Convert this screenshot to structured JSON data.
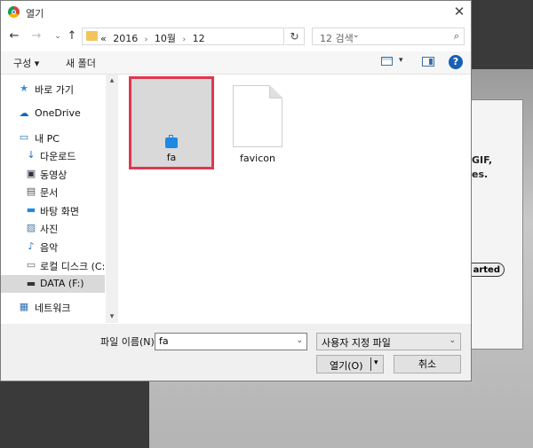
{
  "background_app": {
    "text_gif": "GIF,",
    "text_es": "es.",
    "button_label": "arted"
  },
  "dialog": {
    "title": "열기",
    "close_glyph": "✕"
  },
  "nav": {
    "back_glyph": "←",
    "forward_glyph": "→",
    "up_glyph": "↑",
    "breadcrumb_prefix": "«",
    "breadcrumbs": [
      "2016",
      "10월",
      "12"
    ],
    "breadcrumb_sep": "›",
    "dropdown_glyph": "⌄",
    "refresh_glyph": "↻",
    "search_placeholder": "12 검색",
    "search_glyph": "⌕"
  },
  "toolbar": {
    "organize": "구성 ▾",
    "new_folder": "새 폴더",
    "view_drop": "▾",
    "help": "?"
  },
  "sidebar": {
    "items": [
      {
        "label": "바로 가기",
        "icon": "star-icon",
        "glyph": "★"
      },
      {
        "label": "OneDrive",
        "icon": "cloud-icon",
        "glyph": "☁"
      },
      {
        "label": "내 PC",
        "icon": "computer-icon",
        "glyph": "▭"
      },
      {
        "label": "다운로드",
        "icon": "download-icon",
        "glyph": "↓"
      },
      {
        "label": "동영상",
        "icon": "video-icon",
        "glyph": "▣"
      },
      {
        "label": "문서",
        "icon": "document-icon",
        "glyph": "▤"
      },
      {
        "label": "바탕 화면",
        "icon": "desktop-icon",
        "glyph": "▬"
      },
      {
        "label": "사진",
        "icon": "picture-icon",
        "glyph": "▨"
      },
      {
        "label": "음악",
        "icon": "music-icon",
        "glyph": "♪"
      },
      {
        "label": "로컬 디스크 (C:)",
        "icon": "disk-icon",
        "glyph": "▭"
      },
      {
        "label": "DATA (F:)",
        "icon": "drive-icon",
        "glyph": "▬"
      },
      {
        "label": "네트워크",
        "icon": "network-icon",
        "glyph": "▦"
      }
    ],
    "scroll_up": "▴",
    "scroll_down": "▾"
  },
  "files": [
    {
      "name": "fa",
      "selected": true
    },
    {
      "name": "favicon",
      "selected": false
    }
  ],
  "footer": {
    "filename_label": "파일 이름(N):",
    "filename_value": "fa",
    "filetype_value": "사용자 지정 파일",
    "open_label": "열기(O)",
    "open_drop": "▾",
    "cancel_label": "취소",
    "drop_glyph": "⌄"
  },
  "colors": {
    "selection_border": "#e0384f",
    "accent": "#1a5fb4"
  }
}
